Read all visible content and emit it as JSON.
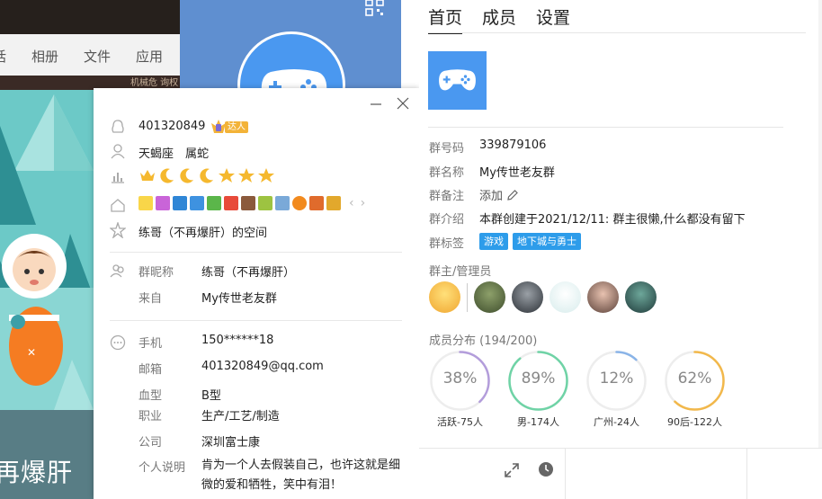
{
  "background": {
    "tabs": [
      "话",
      "相册",
      "文件",
      "应用"
    ],
    "strip_text": "机械危 询权",
    "winter_text": "再爆肝"
  },
  "profile": {
    "qq_number": "401320849",
    "daren_badge": "达人",
    "zodiac": "天蝎座",
    "chinese_zodiac": "属蛇",
    "space_link": "练哥（不再爆肝）的空间",
    "fields": [
      {
        "label": "群昵称",
        "value": "练哥（不再爆肝）"
      },
      {
        "label": "来自",
        "value": "My传世老友群"
      },
      {
        "label": "手机",
        "value": "150******18"
      },
      {
        "label": "邮箱",
        "value": "401320849@qq.com"
      },
      {
        "label": "血型",
        "value": "B型"
      },
      {
        "label": "职业",
        "value": "生产/工艺/制造"
      },
      {
        "label": "公司",
        "value": "深圳富士康"
      },
      {
        "label": "个人说明",
        "value": "肯为一个人去假装自己，也许这就是细微的爱和牺牲，笑中有泪！"
      }
    ],
    "level_icons": [
      "crown-icon",
      "moon-icon",
      "moon-icon",
      "moon-icon",
      "star-icon",
      "star-icon",
      "star-icon"
    ]
  },
  "group": {
    "tabs": [
      "首页",
      "成员",
      "设置"
    ],
    "active_tab": "首页",
    "rows": [
      {
        "label": "群号码",
        "value": "339879106"
      },
      {
        "label": "群名称",
        "value": "My传世老友群"
      },
      {
        "label": "群备注",
        "value": "添加"
      },
      {
        "label": "群介绍",
        "value": "本群创建于2021/12/11:  群主很懒,什么都没有留下"
      },
      {
        "label": "群标签",
        "value": ""
      }
    ],
    "tags": [
      "游戏",
      "地下城与勇士"
    ],
    "admins_title": "群主/管理员",
    "distribution_title": "成员分布",
    "distribution_count": "(194/200)",
    "stats": [
      {
        "percent": 38,
        "label": "38%",
        "caption": "活跃-75人",
        "color": "#b39ddb"
      },
      {
        "percent": 89,
        "label": "89%",
        "caption": "男-174人",
        "color": "#6fd3a6"
      },
      {
        "percent": 12,
        "label": "12%",
        "caption": "广州-24人",
        "color": "#8ab4e8"
      },
      {
        "percent": 62,
        "label": "62%",
        "caption": "90后-122人",
        "color": "#f2b84b"
      }
    ]
  },
  "colors": {
    "accent_blue": "#2d9cea",
    "logo_blue": "#4a98f0"
  }
}
